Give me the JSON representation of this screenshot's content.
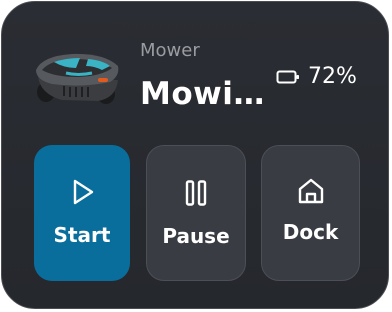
{
  "device": {
    "name": "Mower",
    "status": "Mowi…",
    "battery": "72%"
  },
  "actions": {
    "start_label": "Start",
    "pause_label": "Pause",
    "dock_label": "Dock"
  },
  "colors": {
    "card_bg": "#272a2f",
    "start_bg": "#0a6e9c",
    "secondary_bg": "#393c42",
    "muted_text": "#9a9ca1"
  },
  "icons": {
    "device": "robot-mower-image",
    "battery": "battery-icon",
    "start": "play-icon",
    "pause": "pause-icon",
    "dock": "home-icon"
  }
}
